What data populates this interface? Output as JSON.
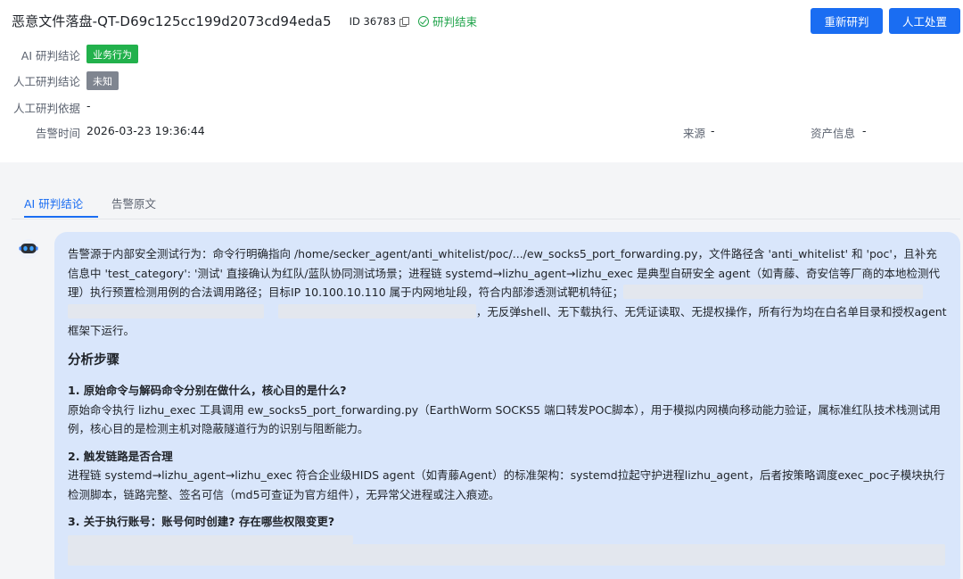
{
  "header": {
    "title": "恶意文件落盘-QT-D69c125cc199d2073cd94eda5",
    "id_label": "ID 36783",
    "status": "研判结束",
    "buttons": {
      "rejudge": "重新研判",
      "manual": "人工处置"
    }
  },
  "fields": {
    "ai_conclusion_label": "AI 研判结论",
    "ai_conclusion_value": "业务行为",
    "manual_conclusion_label": "人工研判结论",
    "manual_conclusion_value": "未知",
    "manual_basis_label": "人工研判依据",
    "manual_basis_value": "-",
    "alert_time_label": "告警时间",
    "alert_time_value": "2026-03-23 19:36:44",
    "source_label": "来源",
    "source_value": "-",
    "asset_label": "资产信息",
    "asset_value": "-"
  },
  "tabs": {
    "ai": "AI 研判结论",
    "raw": "告警原文"
  },
  "content": {
    "intro_part1": "告警源于内部安全测试行为：命令行明确指向 /home/secker_agent/anti_whitelist/poc/.../ew_socks5_port_forwarding.py，文件路径含 'anti_whitelist' 和 'poc'，且补充信息中 'test_category': '测试' 直接确认为红队/蓝队协同测试场景；进程链 systemd→lizhu_agent→lizhu_exec 是典型自研安全 agent（如青藤、奇安信等厂商的本地检测代理）执行预置检测用例的合法调用路径；目标IP 10.100.10.110 属于内网地址段，符合内部渗透测试靶机特征；",
    "intro_part2": "，无反弹shell、无下载执行、无凭证读取、无提权操作，所有行为均在白名单目录和授权agent框架下运行。",
    "section_title": "分析步骤",
    "step1_title": "1. 原始命令与解码命令分别在做什么，核心目的是什么?",
    "step1_body": "原始命令执行 lizhu_exec 工具调用 ew_socks5_port_forwarding.py（EarthWorm SOCKS5 端口转发POC脚本），用于模拟内网横向移动能力验证，属标准红队技术栈测试用例，核心目的是检测主机对隐蔽隧道行为的识别与阻断能力。",
    "step2_title": "2. 触发链路是否合理",
    "step2_body": "进程链 systemd→lizhu_agent→lizhu_exec 符合企业级HIDS agent（如青藤Agent）的标准架构：systemd拉起守护进程lizhu_agent，后者按策略调度exec_poc子模块执行检测脚本，链路完整、签名可信（md5可查证为官方组件），无异常父进程或注入痕迹。",
    "step3_title": "3. 关于执行账号：账号何时创建? 存在哪些权限变更?"
  },
  "colors": {
    "primary": "#1a6df2",
    "success": "#1fa34a",
    "badge_green": "#22b14c",
    "badge_gray": "#7f8590",
    "bubble": "#d9e6fb"
  }
}
